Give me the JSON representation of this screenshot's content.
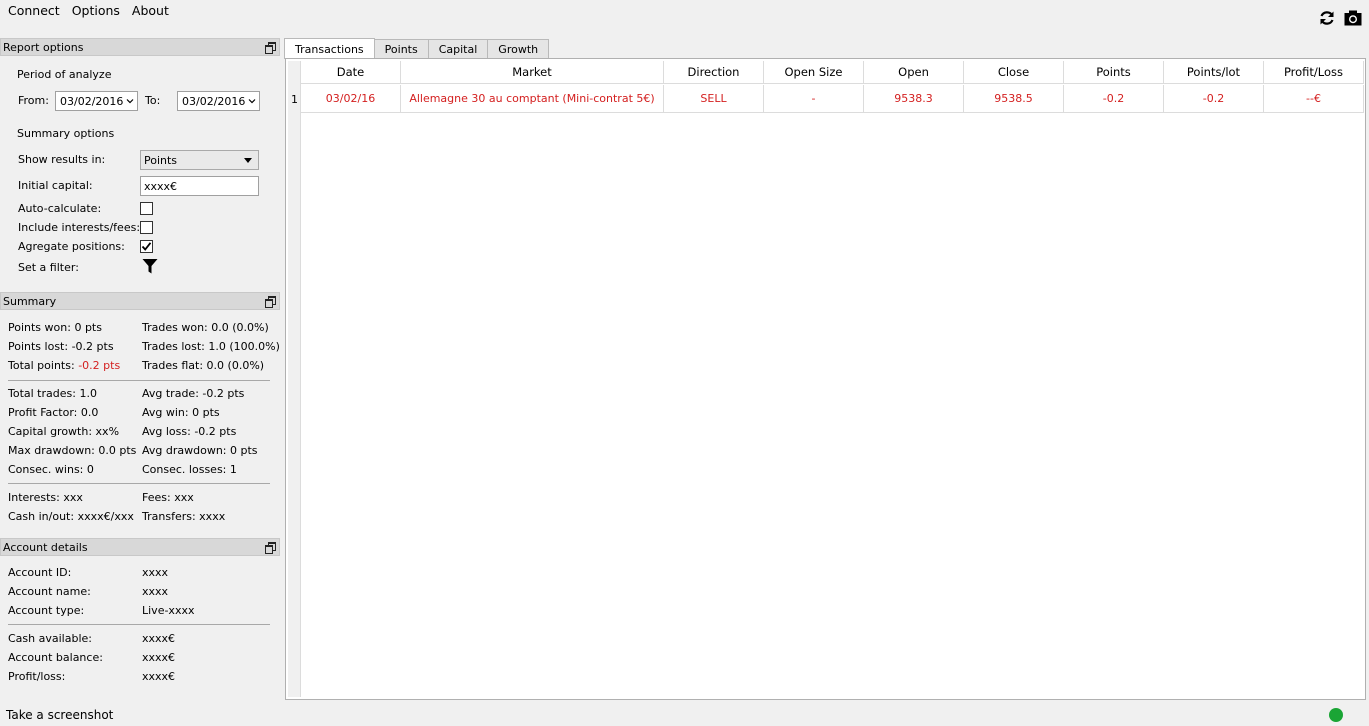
{
  "menu": [
    "Connect",
    "Options",
    "About"
  ],
  "toolbar": {
    "refresh_icon": "refresh-icon",
    "screenshot_icon": "camera-icon"
  },
  "report_options": {
    "title": "Report options",
    "period_label": "Period of analyze",
    "from_label": "From:",
    "from_value": "03/02/2016",
    "to_label": "To:",
    "to_value": "03/02/2016",
    "summary_options_label": "Summary options",
    "show_results_label": "Show results in:",
    "show_results_value": "Points",
    "initial_capital_label": "Initial capital:",
    "initial_capital_value": "xxxx€",
    "auto_calc_label": "Auto-calculate:",
    "auto_calc_checked": false,
    "include_fees_label": "Include interests/fees:",
    "include_fees_checked": false,
    "aggregate_label": "Agregate positions:",
    "aggregate_checked": true,
    "filter_label": "Set a filter:"
  },
  "summary": {
    "title": "Summary",
    "points_won_label": "Points won:",
    "points_won": "0 pts",
    "trades_won_label": "Trades won:",
    "trades_won": "0.0 (0.0%)",
    "points_lost_label": "Points lost:",
    "points_lost": "-0.2 pts",
    "trades_lost_label": "Trades lost:",
    "trades_lost": "1.0 (100.0%)",
    "total_points_label": "Total points:",
    "total_points": "-0.2 pts",
    "trades_flat_label": "Trades flat:",
    "trades_flat": "0.0 (0.0%)",
    "total_trades_label": "Total trades:",
    "total_trades": "1.0",
    "avg_trade_label": "Avg trade:",
    "avg_trade": "-0.2 pts",
    "profit_factor_label": "Profit Factor:",
    "profit_factor": "0.0",
    "avg_win_label": "Avg win:",
    "avg_win": "0 pts",
    "capital_growth_label": "Capital growth:",
    "capital_growth": "xx%",
    "avg_loss_label": "Avg loss:",
    "avg_loss": "-0.2 pts",
    "max_drawdown_label": "Max drawdown:",
    "max_drawdown": "0.0 pts",
    "avg_drawdown_label": "Avg drawdown:",
    "avg_drawdown": "0 pts",
    "consec_wins_label": "Consec. wins:",
    "consec_wins": "0",
    "consec_losses_label": "Consec. losses:",
    "consec_losses": "1",
    "interests_label": "Interests:",
    "interests": "xxx",
    "fees_label": "Fees:",
    "fees": "xxx",
    "cash_inout_label": "Cash in/out:",
    "cash_inout": "xxxx€/xxx",
    "transfers_label": "Transfers:",
    "transfers": "xxxx"
  },
  "account": {
    "title": "Account details",
    "id_label": "Account ID:",
    "id": "xxxx",
    "name_label": "Account name:",
    "name": "xxxx",
    "type_label": "Account type:",
    "type": "Live-xxxx",
    "cash_label": "Cash available:",
    "cash": "xxxx€",
    "balance_label": "Account balance:",
    "balance": "xxxx€",
    "pl_label": "Profit/loss:",
    "pl": "xxxx€"
  },
  "tabs": [
    "Transactions",
    "Points",
    "Capital",
    "Growth"
  ],
  "table": {
    "columns": [
      "Date",
      "Market",
      "Direction",
      "Open Size",
      "Open",
      "Close",
      "Points",
      "Points/lot",
      "Profit/Loss"
    ],
    "rows": [
      {
        "num": "1",
        "cells": [
          "03/02/16",
          "Allemagne 30 au comptant (Mini-contrat 5€)",
          "SELL",
          "-",
          "9538.3",
          "9538.5",
          "-0.2",
          "-0.2",
          "--€"
        ]
      }
    ]
  },
  "statusbar": {
    "text": "Take a screenshot",
    "status_color": "#1aa535"
  }
}
